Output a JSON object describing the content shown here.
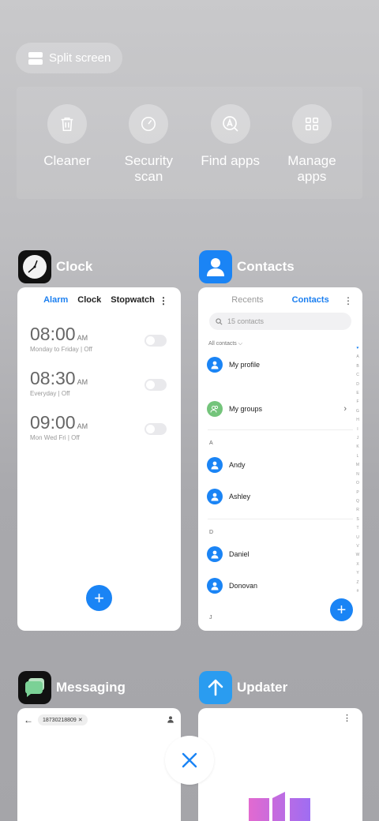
{
  "split_screen": {
    "label": "Split screen"
  },
  "quick_actions": [
    {
      "label": "Cleaner",
      "icon": "trash-icon"
    },
    {
      "label": "Security scan",
      "icon": "speedometer-icon"
    },
    {
      "label": "Find apps",
      "icon": "find-apps-icon"
    },
    {
      "label": "Manage apps",
      "icon": "grid-icon"
    }
  ],
  "apps": {
    "clock": {
      "name": "Clock",
      "tabs": [
        "Alarm",
        "Clock",
        "Stopwatch"
      ],
      "alarms": [
        {
          "time": "08:00",
          "ampm": "AM",
          "detail": "Monday to Friday  |  Off"
        },
        {
          "time": "08:30",
          "ampm": "AM",
          "detail": "Everyday  |  Off"
        },
        {
          "time": "09:00",
          "ampm": "AM",
          "detail": "Mon Wed Fri  |  Off"
        }
      ]
    },
    "contacts": {
      "name": "Contacts",
      "tabs": [
        "Recents",
        "Contacts"
      ],
      "search_placeholder": "15 contacts",
      "filter": "All contacts",
      "my_profile": "My profile",
      "my_groups": "My groups",
      "sections": [
        {
          "letter": "A",
          "names": [
            "Andy",
            "Ashley"
          ]
        },
        {
          "letter": "D",
          "names": [
            "Daniel",
            "Donovan"
          ]
        }
      ],
      "index": "♥ A B C D E F G H I J K L M N O P Q R S T U V W X Y Z #",
      "partial_section": "J"
    },
    "messaging": {
      "name": "Messaging",
      "recipient": "18730218809"
    },
    "updater": {
      "name": "Updater"
    }
  },
  "colors": {
    "accent": "#1a84f5",
    "group_avatar": "#74c47b"
  }
}
